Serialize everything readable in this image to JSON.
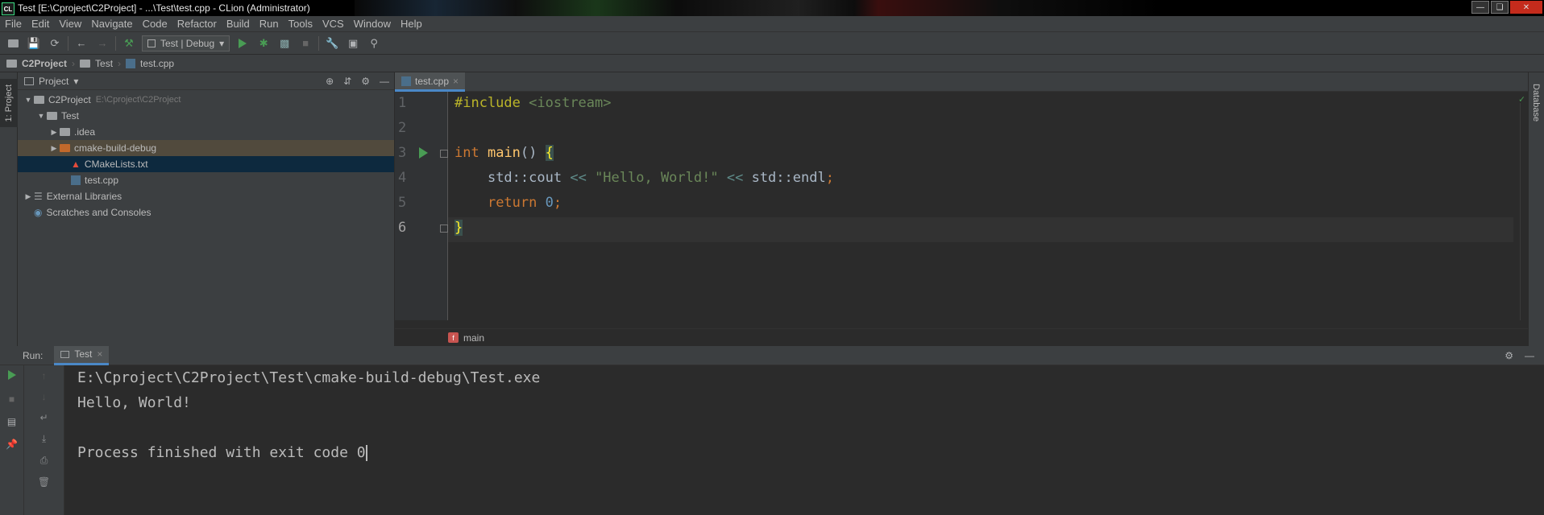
{
  "window": {
    "title": "Test [E:\\Cproject\\C2Project] - ...\\Test\\test.cpp - CLion (Administrator)",
    "logo": "CL"
  },
  "menu": [
    "File",
    "Edit",
    "View",
    "Navigate",
    "Code",
    "Refactor",
    "Build",
    "Run",
    "Tools",
    "VCS",
    "Window",
    "Help"
  ],
  "toolbar": {
    "run_config": "Test | Debug"
  },
  "navbar": {
    "crumbs": [
      "C2Project",
      "Test",
      "test.cpp"
    ]
  },
  "left_strip": {
    "project_tab": "1: Project"
  },
  "project": {
    "header": "Project",
    "tree": [
      {
        "label": "C2Project",
        "path": "E:\\Cproject\\C2Project"
      },
      {
        "label": "Test"
      },
      {
        "label": ".idea"
      },
      {
        "label": "cmake-build-debug"
      },
      {
        "label": "CMakeLists.txt"
      },
      {
        "label": "test.cpp"
      },
      {
        "label": "External Libraries"
      },
      {
        "label": "Scratches and Consoles"
      }
    ]
  },
  "editor": {
    "tab": "test.cpp",
    "line_numbers": [
      "1",
      "2",
      "3",
      "4",
      "5",
      "6"
    ],
    "lines": [
      {
        "pre": "#include",
        "inc": "<iostream>"
      },
      {},
      {
        "kw": "int",
        "fn": "main",
        "paren": "()",
        "brace": "{"
      },
      {
        "ns": "std::cout",
        "op1": "<<",
        "str": "\"Hello, World!\"",
        "op2": "<<",
        "endl": "std::endl",
        "semi": ";"
      },
      {
        "kw": "return",
        "num": "0",
        "semi": ";"
      },
      {
        "brace": "}"
      }
    ],
    "breadcrumb": "main",
    "breadcrumb_badge": "f"
  },
  "right_strip": {
    "database_tab": "Database"
  },
  "run": {
    "label": "Run:",
    "tab": "Test",
    "output": [
      "E:\\Cproject\\C2Project\\Test\\cmake-build-debug\\Test.exe",
      "Hello, World!",
      "",
      "Process finished with exit code 0"
    ]
  },
  "colors": {
    "keyword": "#cc7832",
    "string": "#6a8759",
    "number": "#6897bb",
    "function": "#ffc66d",
    "preprocessor": "#bbb529",
    "run_green": "#499c54",
    "selection": "#0d293e"
  }
}
